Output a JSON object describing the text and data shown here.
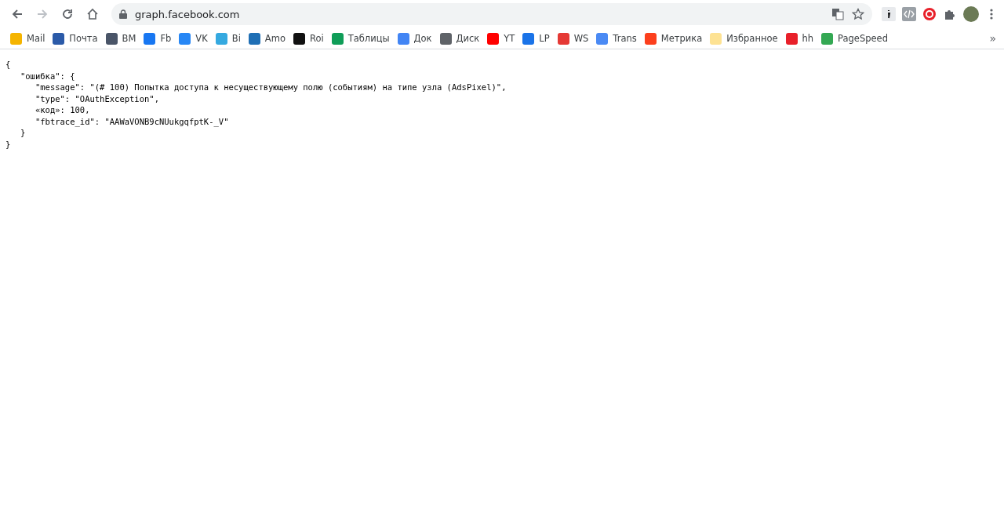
{
  "address_bar": {
    "url": "graph.facebook.com"
  },
  "bookmarks": [
    {
      "label": "Mail",
      "color": "#f5b400"
    },
    {
      "label": "Почта",
      "color": "#2b5aa8"
    },
    {
      "label": "BM",
      "color": "#4a5568"
    },
    {
      "label": "Fb",
      "color": "#1877f2"
    },
    {
      "label": "VK",
      "color": "#2787f5"
    },
    {
      "label": "Bi",
      "color": "#35a9e0"
    },
    {
      "label": "Amo",
      "color": "#1f6fb5"
    },
    {
      "label": "Roi",
      "color": "#111111"
    },
    {
      "label": "Таблицы",
      "color": "#0f9d58"
    },
    {
      "label": "Док",
      "color": "#4285f4"
    },
    {
      "label": "Диск",
      "color": "#5f6368"
    },
    {
      "label": "YT",
      "color": "#ff0000"
    },
    {
      "label": "LP",
      "color": "#1a73e8"
    },
    {
      "label": "WS",
      "color": "#e53935"
    },
    {
      "label": "Trans",
      "color": "#4a8af4"
    },
    {
      "label": "Метрика",
      "color": "#fc3f1d"
    },
    {
      "label": "Избранное",
      "color": "#fde293"
    },
    {
      "label": "hh",
      "color": "#e8202a"
    },
    {
      "label": "PageSpeed",
      "color": "#34a853"
    }
  ],
  "overflow": "»",
  "json_lines": [
    "{",
    "   \"ошибка\": {",
    "      \"message\": \"(# 100) Попытка доступа к несуществующему полю (событиям) на типе узла (AdsPixel)\",",
    "      \"type\": \"OAuthException\",",
    "      «код»: 100,",
    "      \"fbtrace_id\": \"AAWaVONB9cNUukgqfptK-_V\"",
    "   }",
    "}"
  ]
}
